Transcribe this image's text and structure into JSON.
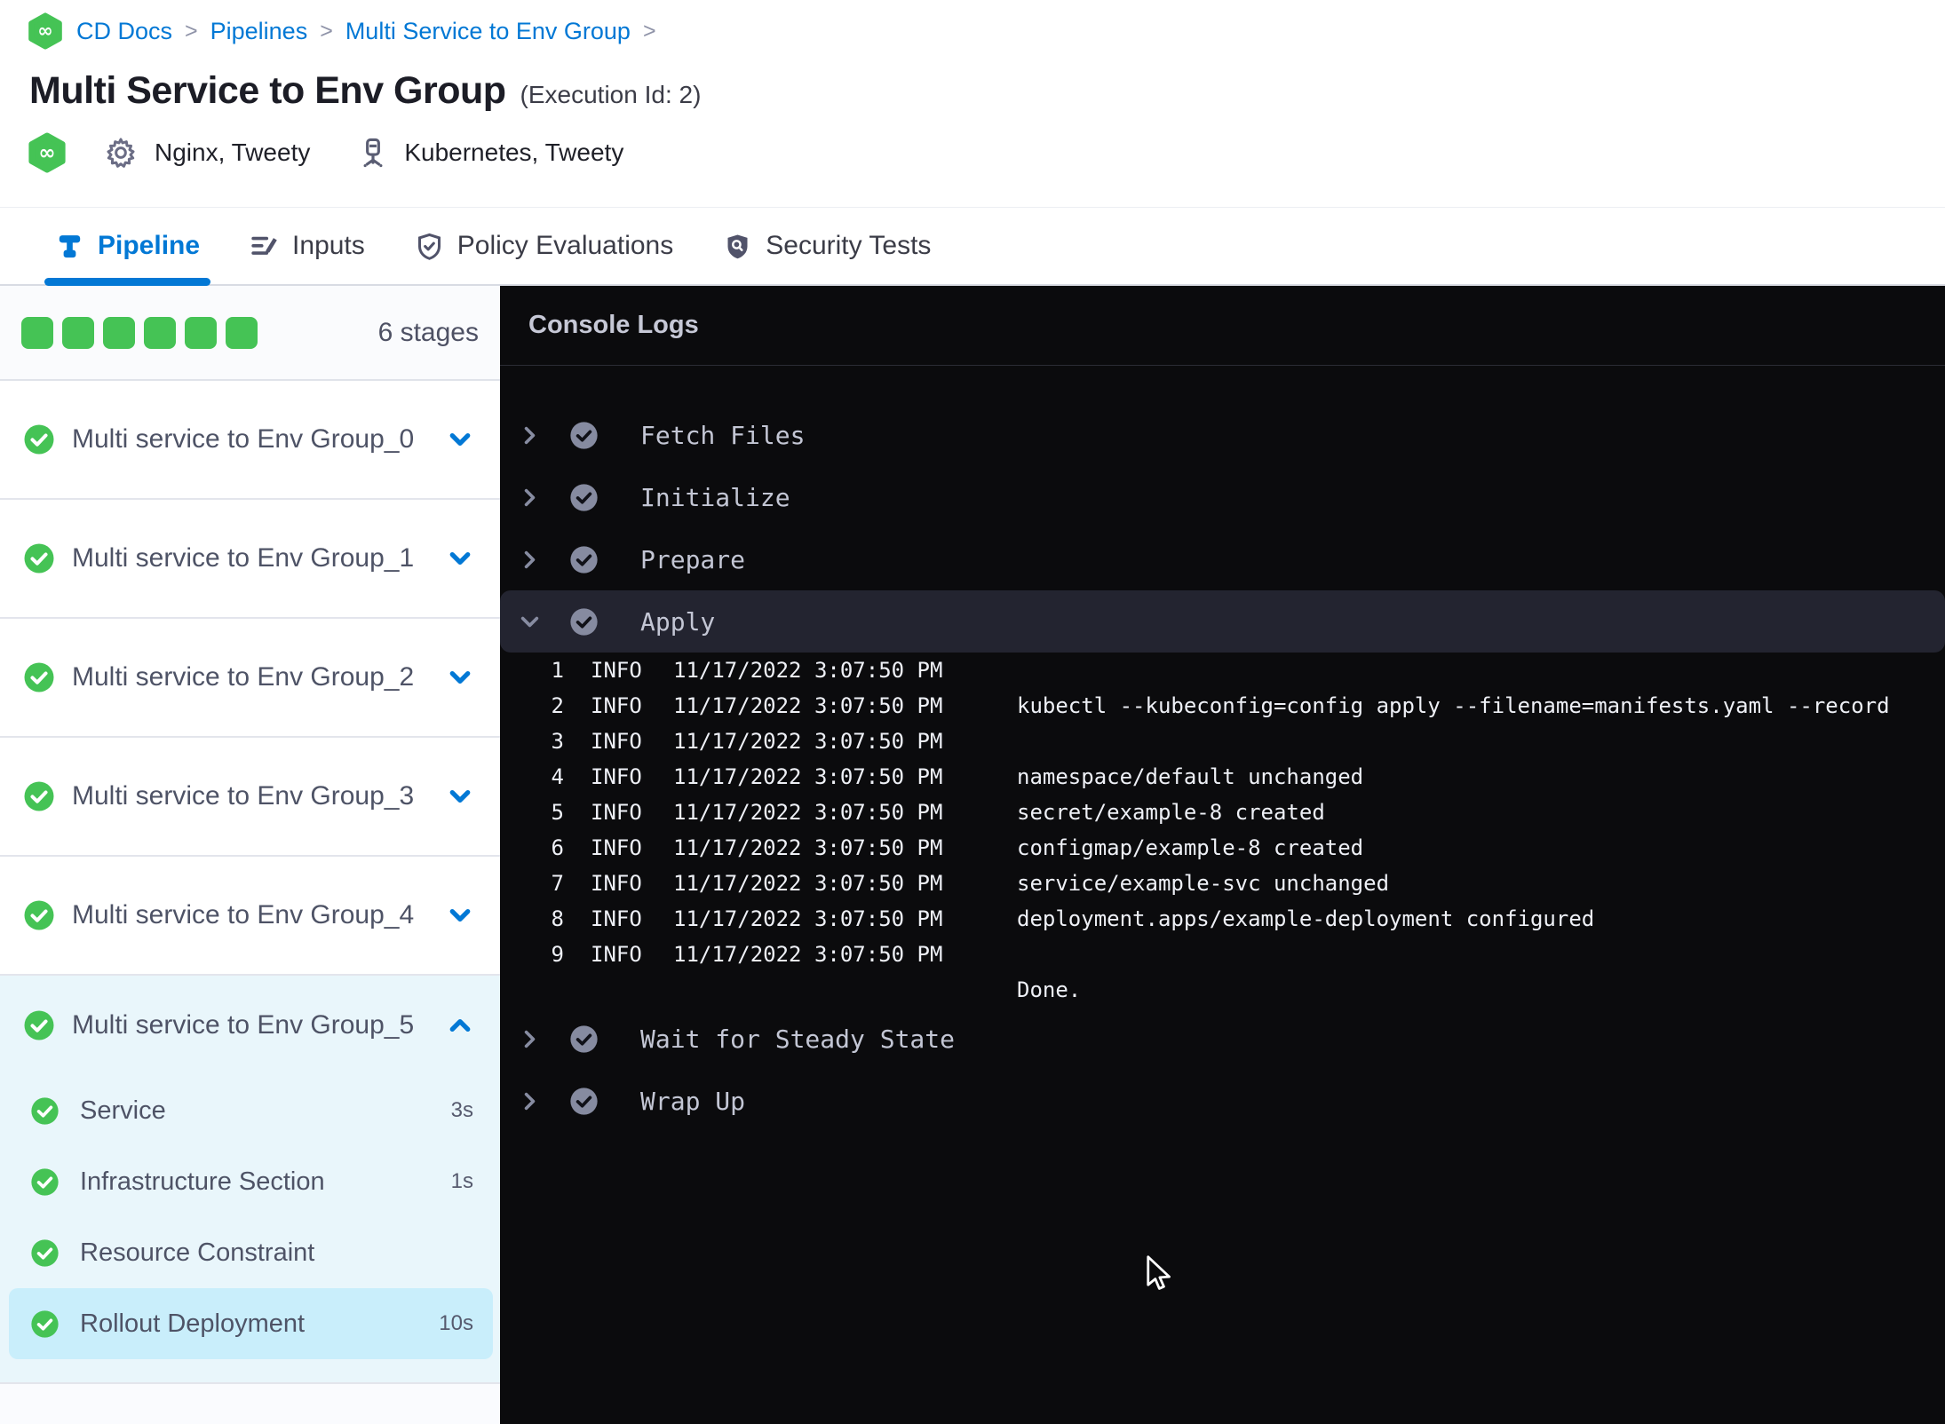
{
  "breadcrumb": {
    "separator": ">",
    "items": [
      "CD Docs",
      "Pipelines",
      "Multi Service to Env Group"
    ]
  },
  "header": {
    "title": "Multi Service to Env Group",
    "execution_id": "(Execution Id: 2)",
    "services_label": "Nginx, Tweety",
    "environments_label": "Kubernetes, Tweety"
  },
  "tabs": [
    {
      "label": "Pipeline",
      "icon": "pipeline-icon",
      "active": true
    },
    {
      "label": "Inputs",
      "icon": "inputs-icon",
      "active": false
    },
    {
      "label": "Policy Evaluations",
      "icon": "policy-evaluations-icon",
      "active": false
    },
    {
      "label": "Security Tests",
      "icon": "security-tests-icon",
      "active": false
    }
  ],
  "sidebar": {
    "stage_count_label": "6 stages",
    "progress_squares": 6,
    "stages": [
      {
        "name": "Multi service to Env Group_0",
        "status": "success",
        "expanded": false
      },
      {
        "name": "Multi service to Env Group_1",
        "status": "success",
        "expanded": false
      },
      {
        "name": "Multi service to Env Group_2",
        "status": "success",
        "expanded": false
      },
      {
        "name": "Multi service to Env Group_3",
        "status": "success",
        "expanded": false
      },
      {
        "name": "Multi service to Env Group_4",
        "status": "success",
        "expanded": false
      },
      {
        "name": "Multi service to Env Group_5",
        "status": "success",
        "expanded": true,
        "steps": [
          {
            "name": "Service",
            "duration": "3s",
            "status": "success",
            "selected": false
          },
          {
            "name": "Infrastructure Section",
            "duration": "1s",
            "status": "success",
            "selected": false
          },
          {
            "name": "Resource Constraint",
            "duration": "",
            "status": "success",
            "selected": false
          },
          {
            "name": "Rollout Deployment",
            "duration": "10s",
            "status": "success",
            "selected": true
          }
        ]
      }
    ]
  },
  "console": {
    "title": "Console Logs",
    "sections": [
      {
        "name": "Fetch Files",
        "status": "success",
        "expanded": false
      },
      {
        "name": "Initialize",
        "status": "success",
        "expanded": false
      },
      {
        "name": "Prepare",
        "status": "success",
        "expanded": false
      },
      {
        "name": "Apply",
        "status": "success",
        "expanded": true,
        "logs": [
          {
            "n": "1",
            "level": "INFO",
            "time": "11/17/2022 3:07:50 PM",
            "message": ""
          },
          {
            "n": "2",
            "level": "INFO",
            "time": "11/17/2022 3:07:50 PM",
            "message": "kubectl --kubeconfig=config apply --filename=manifests.yaml --record"
          },
          {
            "n": "3",
            "level": "INFO",
            "time": "11/17/2022 3:07:50 PM",
            "message": ""
          },
          {
            "n": "4",
            "level": "INFO",
            "time": "11/17/2022 3:07:50 PM",
            "message": "namespace/default unchanged"
          },
          {
            "n": "5",
            "level": "INFO",
            "time": "11/17/2022 3:07:50 PM",
            "message": "secret/example-8 created"
          },
          {
            "n": "6",
            "level": "INFO",
            "time": "11/17/2022 3:07:50 PM",
            "message": "configmap/example-8 created"
          },
          {
            "n": "7",
            "level": "INFO",
            "time": "11/17/2022 3:07:50 PM",
            "message": "service/example-svc unchanged"
          },
          {
            "n": "8",
            "level": "INFO",
            "time": "11/17/2022 3:07:50 PM",
            "message": "deployment.apps/example-deployment configured"
          },
          {
            "n": "9",
            "level": "INFO",
            "time": "11/17/2022 3:07:50 PM",
            "message": ""
          }
        ],
        "closing_line": "Done."
      },
      {
        "name": "Wait for Steady State",
        "status": "success",
        "expanded": false
      },
      {
        "name": "Wrap Up",
        "status": "success",
        "expanded": false
      }
    ]
  },
  "colors": {
    "accent_blue": "#0278d5",
    "success_green": "#45c355",
    "console_bg": "#0b0b0d",
    "console_row_bg": "#232430",
    "expanded_bg": "#e9f6fb",
    "selected_step_bg": "#c9eefb",
    "sidebar_muted": "#fafbfd"
  }
}
